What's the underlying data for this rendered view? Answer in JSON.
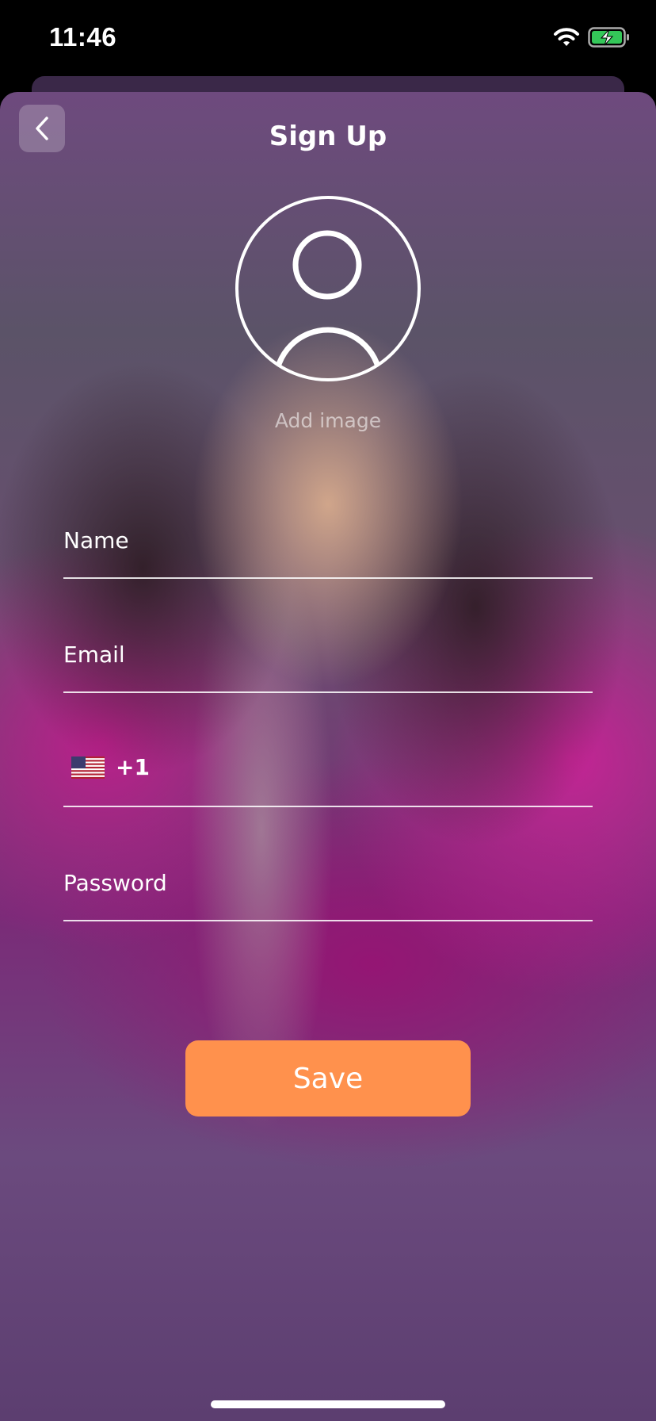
{
  "status_bar": {
    "time": "11:46",
    "wifi_icon": "wifi-icon",
    "battery_icon": "battery-charging-icon",
    "battery_color": "#34c759"
  },
  "header": {
    "title": "Sign Up",
    "back_icon": "chevron-left-icon"
  },
  "avatar": {
    "icon": "user-avatar-icon",
    "add_image_label": "Add image"
  },
  "form": {
    "name_label": "Name",
    "email_label": "Email",
    "phone": {
      "flag_icon": "us-flag-icon",
      "country_code": "+1"
    },
    "password_label": "Password"
  },
  "save_button": {
    "label": "Save",
    "color": "#ff914d"
  }
}
